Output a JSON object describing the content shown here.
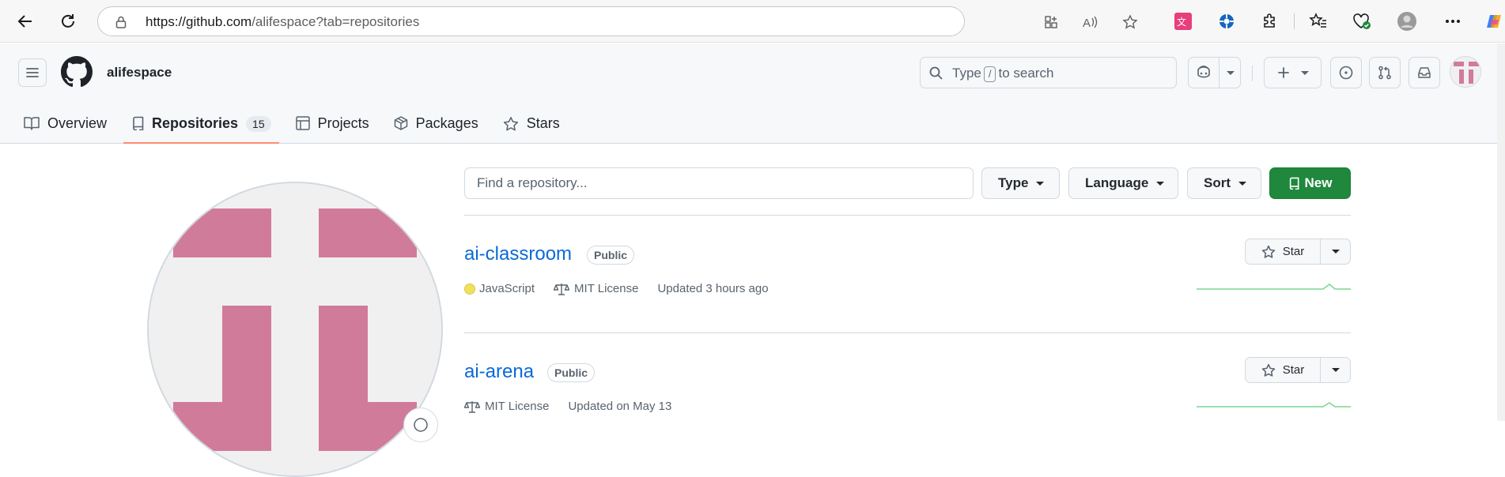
{
  "browser": {
    "url_host": "https://github.com",
    "url_path": "/alifespace?tab=repositories"
  },
  "header": {
    "username": "alifespace",
    "search_prefix": "Type",
    "search_key": "/",
    "search_suffix": "to search"
  },
  "tabs": [
    {
      "label": "Overview",
      "icon": "book-icon"
    },
    {
      "label": "Repositories",
      "icon": "repo-icon",
      "count": "15",
      "active": true
    },
    {
      "label": "Projects",
      "icon": "table-icon"
    },
    {
      "label": "Packages",
      "icon": "package-icon"
    },
    {
      "label": "Stars",
      "icon": "star-icon"
    }
  ],
  "filters": {
    "search_placeholder": "Find a repository...",
    "type_label": "Type",
    "language_label": "Language",
    "sort_label": "Sort",
    "new_label": "New"
  },
  "repos": [
    {
      "name": "ai-classroom",
      "visibility": "Public",
      "language": "JavaScript",
      "language_color": "#f1e05a",
      "license": "MIT License",
      "updated": "Updated 3 hours ago",
      "star_label": "Star"
    },
    {
      "name": "ai-arena",
      "visibility": "Public",
      "license": "MIT License",
      "updated": "Updated on May 13",
      "star_label": "Star"
    }
  ],
  "colors": {
    "accent_link": "#0969da",
    "new_button": "#1f883d",
    "tab_underline": "#fd8c73",
    "avatar_pink": "#d17b9b"
  }
}
